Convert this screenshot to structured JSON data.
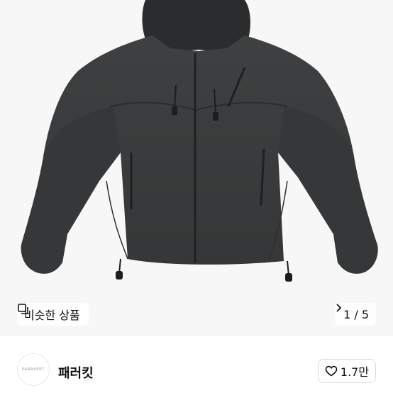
{
  "product": {
    "image_alt": "black hooded puffer jacket",
    "similar_label": "비슷한 상품",
    "similar_icon": "similar-items-icon",
    "pager_text": "1 / 5",
    "pager_icon": "chevron-right-icon"
  },
  "seller": {
    "avatar_text": "PARAKEET",
    "name": "패러킷",
    "like_icon": "heart-outline-icon",
    "like_count": "1.7만"
  },
  "colors": {
    "background": "#ffffff",
    "image_bg": "#f7f7f7",
    "jacket": "#3a3c3d",
    "text": "#111111"
  }
}
